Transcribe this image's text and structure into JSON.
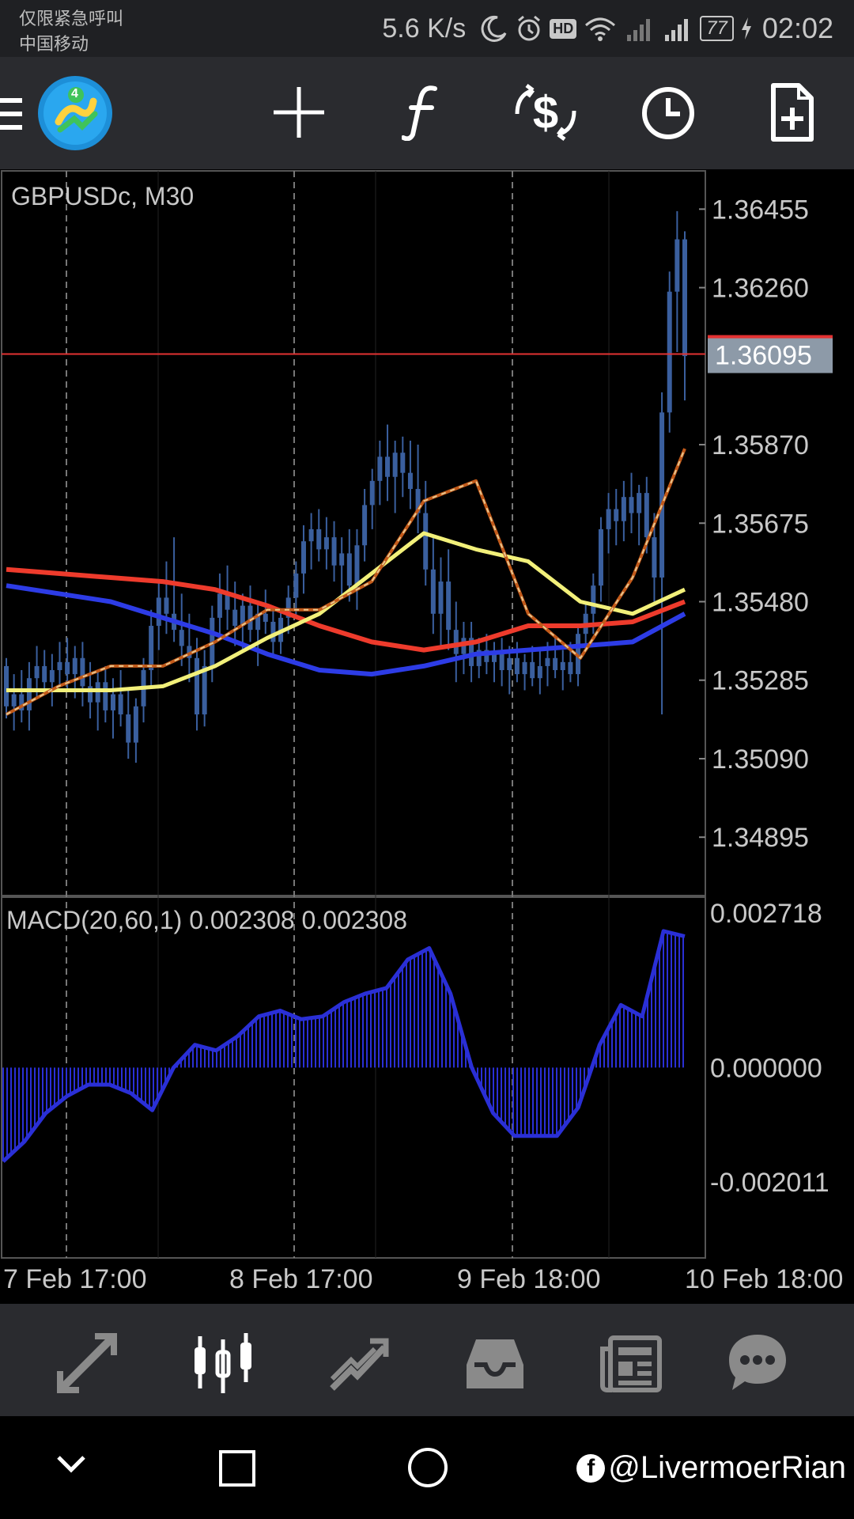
{
  "status_bar": {
    "carrier_line1": "仅限紧急呼叫",
    "carrier_line2": "中国移动",
    "network_speed": "5.6 K/s",
    "hd_badge": "HD",
    "battery": "77",
    "time": "02:02",
    "icons": [
      "moon-icon",
      "alarm-icon",
      "wifi-icon",
      "signal-icon",
      "charging-icon"
    ]
  },
  "toolbar": {
    "icons": [
      "menu-icon",
      "app-logo-icon",
      "crosshair-icon",
      "indicators-f-icon",
      "symbols-dollar-icon",
      "timeframe-clock-icon",
      "new-order-icon"
    ],
    "logo_badge": "4"
  },
  "colors": {
    "background": "#000000",
    "toolbar": "#2a2b2f",
    "ma_red": "#ee3b2c",
    "ma_blue": "#2d3ce6",
    "ma_yellow": "#f2f07a",
    "ma_fast": "#c25a1a",
    "candle": "#3a5f9e",
    "price_line": "#e23232",
    "price_tag_bg": "#8d9aa8",
    "macd": "#2a2fd6"
  },
  "chart": {
    "symbol_label": "GBPUSDc, M30",
    "current_price": "1.36095",
    "macd_label": "MACD(20,60,1) 0.002308 0.002308",
    "bottom_nav_icons": [
      "trade-icon",
      "chart-icon",
      "history-icon",
      "mailbox-icon",
      "news-icon",
      "chat-icon"
    ],
    "sys_nav_icons": [
      "back-chevron-icon",
      "recents-square-icon",
      "home-circle-icon"
    ]
  },
  "chart_data": [
    {
      "type": "line",
      "title": "GBPUSDc, M30",
      "ylim": [
        1.3475,
        1.3655
      ],
      "y_ticks": [
        "1.36455",
        "1.36260",
        "1.35870",
        "1.35675",
        "1.35480",
        "1.35285",
        "1.35090",
        "1.34895"
      ],
      "x_ticks": [
        "7 Feb 17:00",
        "8 Feb 17:00",
        "9 Feb 18:00",
        "10 Feb 18:00"
      ],
      "current_price": 1.36095,
      "candles": [
        [
          1.3532,
          1.3534,
          1.3519,
          1.3522
        ],
        [
          1.3522,
          1.353,
          1.3516,
          1.3525
        ],
        [
          1.3525,
          1.3531,
          1.3518,
          1.3521
        ],
        [
          1.3521,
          1.3533,
          1.3516,
          1.3529
        ],
        [
          1.3529,
          1.3537,
          1.3524,
          1.3532
        ],
        [
          1.3532,
          1.3536,
          1.3525,
          1.3528
        ],
        [
          1.3528,
          1.3535,
          1.3522,
          1.3531
        ],
        [
          1.3531,
          1.3538,
          1.3527,
          1.3533
        ],
        [
          1.3533,
          1.3539,
          1.3526,
          1.353
        ],
        [
          1.353,
          1.3537,
          1.3524,
          1.3534
        ],
        [
          1.3534,
          1.3538,
          1.3522,
          1.3527
        ],
        [
          1.3527,
          1.3533,
          1.3519,
          1.3523
        ],
        [
          1.3523,
          1.3531,
          1.3516,
          1.3528
        ],
        [
          1.3528,
          1.3532,
          1.3518,
          1.3521
        ],
        [
          1.3521,
          1.3529,
          1.3514,
          1.3525
        ],
        [
          1.3525,
          1.3531,
          1.3517,
          1.352
        ],
        [
          1.352,
          1.3526,
          1.3509,
          1.3513
        ],
        [
          1.3513,
          1.3524,
          1.3508,
          1.3522
        ],
        [
          1.3522,
          1.3534,
          1.3518,
          1.3531
        ],
        [
          1.3531,
          1.3546,
          1.3527,
          1.3542
        ],
        [
          1.3542,
          1.3553,
          1.3536,
          1.3549
        ],
        [
          1.3549,
          1.3558,
          1.354,
          1.3545
        ],
        [
          1.3545,
          1.3564,
          1.3538,
          1.3541
        ],
        [
          1.3541,
          1.355,
          1.3532,
          1.3537
        ],
        [
          1.3537,
          1.3545,
          1.3528,
          1.3534
        ],
        [
          1.3534,
          1.3539,
          1.3516,
          1.352
        ],
        [
          1.352,
          1.3536,
          1.3517,
          1.3532
        ],
        [
          1.3532,
          1.3547,
          1.3528,
          1.3544
        ],
        [
          1.3544,
          1.3555,
          1.3539,
          1.355
        ],
        [
          1.355,
          1.3557,
          1.3541,
          1.3546
        ],
        [
          1.3546,
          1.3553,
          1.3537,
          1.3542
        ],
        [
          1.3542,
          1.355,
          1.3536,
          1.3547
        ],
        [
          1.3547,
          1.3552,
          1.3538,
          1.3541
        ],
        [
          1.3541,
          1.3548,
          1.3532,
          1.3545
        ],
        [
          1.3545,
          1.3551,
          1.354,
          1.3543
        ],
        [
          1.3543,
          1.3547,
          1.3534,
          1.3538
        ],
        [
          1.3538,
          1.3546,
          1.3535,
          1.3544
        ],
        [
          1.3544,
          1.3552,
          1.354,
          1.3549
        ],
        [
          1.3549,
          1.3558,
          1.3544,
          1.3555
        ],
        [
          1.3555,
          1.3567,
          1.355,
          1.3563
        ],
        [
          1.3563,
          1.357,
          1.3556,
          1.3566
        ],
        [
          1.3566,
          1.3571,
          1.3558,
          1.3561
        ],
        [
          1.3561,
          1.3569,
          1.3556,
          1.3564
        ],
        [
          1.3564,
          1.3568,
          1.3553,
          1.3557
        ],
        [
          1.3557,
          1.3564,
          1.3549,
          1.356
        ],
        [
          1.356,
          1.3566,
          1.3548,
          1.3552
        ],
        [
          1.3552,
          1.3566,
          1.3546,
          1.3562
        ],
        [
          1.3562,
          1.3576,
          1.3558,
          1.3572
        ],
        [
          1.3572,
          1.3581,
          1.3566,
          1.3578
        ],
        [
          1.3578,
          1.3588,
          1.3572,
          1.3584
        ],
        [
          1.3584,
          1.3592,
          1.3573,
          1.3579
        ],
        [
          1.3579,
          1.3588,
          1.357,
          1.3585
        ],
        [
          1.3585,
          1.3589,
          1.3574,
          1.358
        ],
        [
          1.358,
          1.3588,
          1.3571,
          1.3576
        ],
        [
          1.3576,
          1.3587,
          1.3565,
          1.357
        ],
        [
          1.357,
          1.3578,
          1.3552,
          1.3556
        ],
        [
          1.3556,
          1.3564,
          1.354,
          1.3545
        ],
        [
          1.3545,
          1.3559,
          1.3537,
          1.3553
        ],
        [
          1.3553,
          1.3561,
          1.3536,
          1.3541
        ],
        [
          1.3541,
          1.3548,
          1.3528,
          1.3535
        ],
        [
          1.3535,
          1.3543,
          1.353,
          1.3539
        ],
        [
          1.3539,
          1.3543,
          1.3528,
          1.3532
        ],
        [
          1.3532,
          1.3539,
          1.3529,
          1.3536
        ],
        [
          1.3536,
          1.354,
          1.353,
          1.3533
        ],
        [
          1.3533,
          1.3538,
          1.3528,
          1.3535
        ],
        [
          1.3535,
          1.3539,
          1.3527,
          1.3531
        ],
        [
          1.3531,
          1.3537,
          1.3525,
          1.3534
        ],
        [
          1.3534,
          1.3538,
          1.3528,
          1.353
        ],
        [
          1.353,
          1.3535,
          1.3526,
          1.3533
        ],
        [
          1.3533,
          1.3537,
          1.3527,
          1.3529
        ],
        [
          1.3529,
          1.3536,
          1.3525,
          1.3532
        ],
        [
          1.3532,
          1.3538,
          1.3527,
          1.3534
        ],
        [
          1.3534,
          1.3539,
          1.3529,
          1.3531
        ],
        [
          1.3531,
          1.3536,
          1.3526,
          1.3533
        ],
        [
          1.3533,
          1.3538,
          1.3528,
          1.353
        ],
        [
          1.353,
          1.3542,
          1.3527,
          1.354
        ],
        [
          1.354,
          1.3548,
          1.3536,
          1.3545
        ],
        [
          1.3545,
          1.3555,
          1.354,
          1.3552
        ],
        [
          1.3552,
          1.3569,
          1.3548,
          1.3566
        ],
        [
          1.3566,
          1.3575,
          1.356,
          1.3571
        ],
        [
          1.3571,
          1.3576,
          1.3562,
          1.3568
        ],
        [
          1.3568,
          1.3578,
          1.3563,
          1.3574
        ],
        [
          1.3574,
          1.358,
          1.3565,
          1.357
        ],
        [
          1.357,
          1.3577,
          1.3562,
          1.3575
        ],
        [
          1.3575,
          1.3579,
          1.356,
          1.3564
        ],
        [
          1.3564,
          1.357,
          1.3548,
          1.3554
        ],
        [
          1.3554,
          1.36,
          1.352,
          1.3595
        ],
        [
          1.3595,
          1.363,
          1.359,
          1.3625
        ],
        [
          1.3625,
          1.3645,
          1.361,
          1.3638
        ],
        [
          1.3638,
          1.364,
          1.3598,
          1.3609
        ]
      ],
      "ma_red": [
        1.3556,
        1.3555,
        1.3554,
        1.3553,
        1.3551,
        1.3547,
        1.3542,
        1.3538,
        1.3536,
        1.3538,
        1.3542,
        1.3542,
        1.3543,
        1.3548
      ],
      "ma_blue": [
        1.3552,
        1.355,
        1.3548,
        1.3544,
        1.354,
        1.3535,
        1.3531,
        1.353,
        1.3532,
        1.3535,
        1.3536,
        1.3537,
        1.3538,
        1.3545
      ],
      "ma_yellow": [
        1.3526,
        1.3526,
        1.3526,
        1.3527,
        1.3532,
        1.3539,
        1.3545,
        1.3555,
        1.3565,
        1.3561,
        1.3558,
        1.3548,
        1.3545,
        1.3551
      ],
      "ma_fast": [
        1.352,
        1.3527,
        1.3532,
        1.3532,
        1.3538,
        1.3546,
        1.3546,
        1.3553,
        1.3573,
        1.3578,
        1.3545,
        1.3534,
        1.3554,
        1.3586
      ]
    },
    {
      "type": "area",
      "title": "MACD(20,60,1) 0.002308 0.002308",
      "ylim": [
        -0.002011,
        0.002718
      ],
      "y_ticks": [
        "0.002718",
        "0.000000",
        "-0.002011"
      ],
      "values": [
        -0.00165,
        -0.0013,
        -0.0008,
        -0.0005,
        -0.0003,
        -0.0003,
        -0.00045,
        -0.00075,
        0.0,
        0.0004,
        0.0003,
        0.00055,
        0.0009,
        0.001,
        0.00085,
        0.0009,
        0.00115,
        0.0013,
        0.0014,
        0.0019,
        0.0021,
        0.0013,
        0.0,
        -0.0008,
        -0.0012,
        -0.0012,
        -0.0012,
        -0.0007,
        0.0004,
        0.0011,
        0.0009,
        0.0024,
        0.002308
      ]
    }
  ]
}
